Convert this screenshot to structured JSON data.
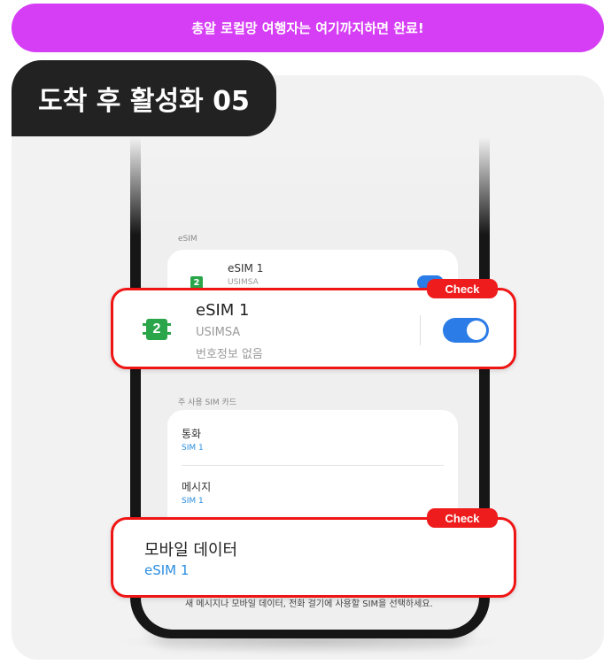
{
  "banner": {
    "text": "총알 로컬망 여행자는 여기까지하면 완료!"
  },
  "step": {
    "title": "도착 후 활성화 05"
  },
  "screen": {
    "esim_section_label": "eSIM",
    "esim_card_bg": {
      "name": "eSIM 1",
      "carrier": "USIMSA"
    },
    "primary_sim_label": "주 사용 SIM 카드",
    "calls": {
      "label": "통화",
      "value": "SIM 1"
    },
    "messages": {
      "label": "메시지",
      "value": "SIM 1"
    },
    "note": "새 메시지나 모바일 데이터, 전화 걸기에 사용할 SIM을 선택하세요."
  },
  "callout_esim": {
    "badge": "Check",
    "chip_number": "2",
    "name": "eSIM 1",
    "carrier": "USIMSA",
    "number_info": "번호정보 없음",
    "toggle_on": true
  },
  "callout_data": {
    "badge": "Check",
    "label": "모바일 데이터",
    "value": "eSIM 1"
  },
  "colors": {
    "banner": "#d63ef5",
    "highlight": "#f01515",
    "toggle": "#2b7ce6",
    "sim_chip": "#2aa54a",
    "link_blue": "#2b8de0"
  },
  "icons": {
    "sim": "sim-card-icon",
    "toggle": "toggle-switch"
  }
}
